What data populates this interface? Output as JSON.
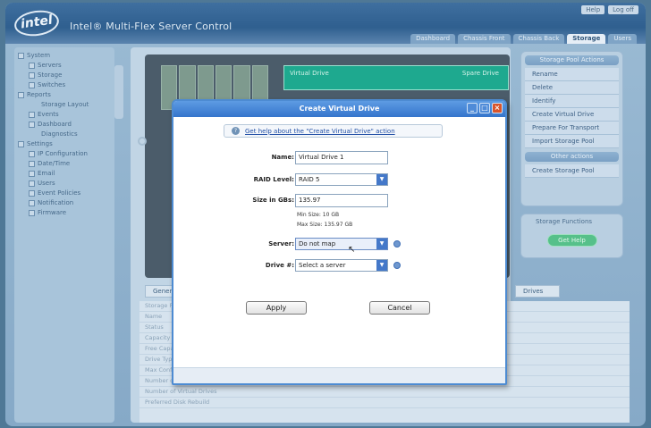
{
  "app": {
    "logo": "intel",
    "title": "Intel® Multi-Flex Server Control"
  },
  "top_links": [
    "Help",
    "Log off"
  ],
  "tabs": [
    "Dashboard",
    "Chassis Front",
    "Chassis Back",
    "Storage",
    "Users"
  ],
  "active_tab": "Storage",
  "nav": [
    {
      "label": "System",
      "level": 0
    },
    {
      "label": "Servers",
      "level": 1
    },
    {
      "label": "Storage",
      "level": 1
    },
    {
      "label": "Switches",
      "level": 1
    },
    {
      "label": "Reports",
      "level": 0
    },
    {
      "label": "Storage Layout",
      "level": 2
    },
    {
      "label": "Events",
      "level": 1
    },
    {
      "label": "Dashboard",
      "level": 1
    },
    {
      "label": "Diagnostics",
      "level": 2
    },
    {
      "label": "Settings",
      "level": 0
    },
    {
      "label": "IP Configuration",
      "level": 1
    },
    {
      "label": "Date/Time",
      "level": 1
    },
    {
      "label": "Email",
      "level": 1
    },
    {
      "label": "Users",
      "level": 1
    },
    {
      "label": "Event Policies",
      "level": 1
    },
    {
      "label": "Notification",
      "level": 1
    },
    {
      "label": "Firmware",
      "level": 1
    }
  ],
  "enclosure": {
    "drive_label": "Virtual Drive",
    "drive_label_right": "Spare Drive"
  },
  "detail": {
    "tabs": [
      "General"
    ],
    "tab_right": "Drives",
    "rows": [
      {
        "label": "Storage Pool",
        "value": ""
      },
      {
        "label": "Name",
        "value": ""
      },
      {
        "label": "Status",
        "value": ""
      },
      {
        "label": "Capacity",
        "value": ""
      },
      {
        "label": "Free Capacity",
        "value": ""
      },
      {
        "label": "Drive Type",
        "value": ""
      },
      {
        "label": "Max Configurable Space",
        "value": ""
      },
      {
        "label": "Number of Drives",
        "value": ""
      },
      {
        "label": "Number of Virtual Drives",
        "value": ""
      },
      {
        "label": "Preferred Disk Rebuild",
        "value": ""
      }
    ]
  },
  "actions": {
    "title": "Storage Pool Actions",
    "items": [
      "Rename",
      "Delete",
      "Identify",
      "Create Virtual Drive",
      "Prepare For Transport",
      "Import Storage Pool"
    ],
    "sub_title": "Other actions",
    "sub_items": [
      "Create Storage Pool"
    ]
  },
  "functions": {
    "title": "Storage Functions",
    "button": "Get Help"
  },
  "dialog": {
    "title": "Create Virtual Drive",
    "help_link": "Get help about the \"Create Virtual Drive\" action",
    "fields": {
      "name_label": "Name:",
      "name_value": "Virtual Drive 1",
      "raid_label": "RAID Level:",
      "raid_value": "RAID 5",
      "size_label": "Size in GBs:",
      "size_value": "135.97",
      "min_size": "Min Size: 10 GB",
      "max_size": "Max Size: 135.97 GB",
      "server_label": "Server:",
      "server_value": "Do not map",
      "drive_label": "Drive #:",
      "drive_value": "Select a server"
    },
    "apply": "Apply",
    "cancel": "Cancel"
  }
}
